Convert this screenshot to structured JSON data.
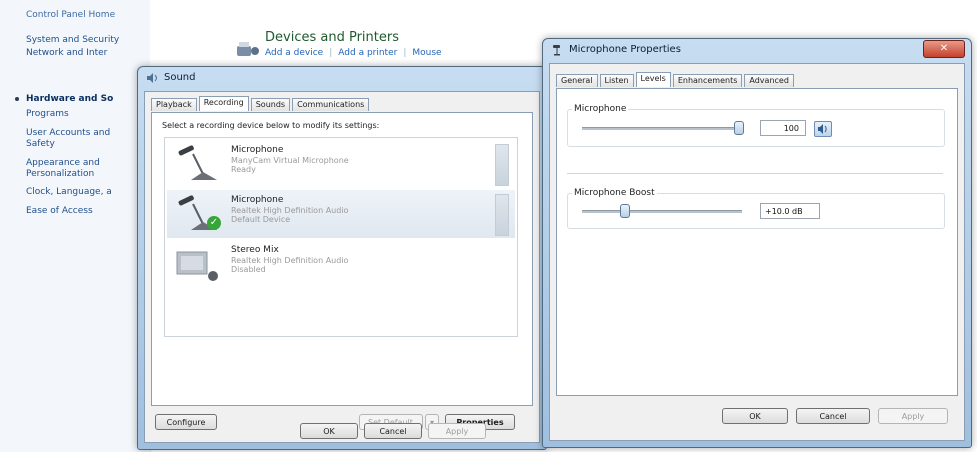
{
  "control_panel": {
    "sidebar": [
      {
        "label": "Control Panel Home",
        "style": "home"
      },
      {
        "label": "System and Security",
        "style": ""
      },
      {
        "label": "Network and Inter",
        "style": ""
      },
      {
        "label": "Hardware and So",
        "style": "bold"
      },
      {
        "label": "Programs",
        "style": ""
      },
      {
        "label": "User Accounts and\nSafety",
        "style": ""
      },
      {
        "label": "Appearance and\nPersonalization",
        "style": ""
      },
      {
        "label": "Clock, Language, a",
        "style": ""
      },
      {
        "label": "Ease of Access",
        "style": ""
      }
    ],
    "header": {
      "title": "Devices and Printers",
      "links": [
        "Add a device",
        "Add a printer",
        "Mouse"
      ]
    }
  },
  "sound_window": {
    "title": "Sound",
    "tabs": [
      "Playback",
      "Recording",
      "Sounds",
      "Communications"
    ],
    "active_tab": "Recording",
    "instruction": "Select a recording device below to modify its settings:",
    "devices": [
      {
        "name": "Microphone",
        "desc": "ManyCam Virtual Microphone",
        "status": "Ready",
        "icon": "microphone-icon"
      },
      {
        "name": "Microphone",
        "desc": "Realtek High Definition Audio",
        "status": "Default Device",
        "icon": "microphone-icon"
      },
      {
        "name": "Stereo Mix",
        "desc": "Realtek High Definition Audio",
        "status": "Disabled",
        "icon": "stereo-mix-icon"
      }
    ],
    "buttons": {
      "configure": "Configure",
      "set_default": "Set Default",
      "properties": "Properties",
      "ok": "OK",
      "cancel": "Cancel",
      "apply": "Apply"
    }
  },
  "mic_properties": {
    "title": "Microphone Properties",
    "tabs": [
      "General",
      "Listen",
      "Levels",
      "Enhancements",
      "Advanced"
    ],
    "active_tab": "Levels",
    "microphone": {
      "label": "Microphone",
      "value": "100",
      "level": 1.0
    },
    "boost": {
      "label": "Microphone Boost",
      "value": "+10.0 dB",
      "level": 0.25
    },
    "buttons": {
      "ok": "OK",
      "cancel": "Cancel",
      "apply": "Apply"
    }
  },
  "colors": {
    "accent_green": "#37a63a",
    "title_green": "#1e5a2e",
    "link_blue": "#2466b8",
    "close_red": "#c4412b"
  }
}
